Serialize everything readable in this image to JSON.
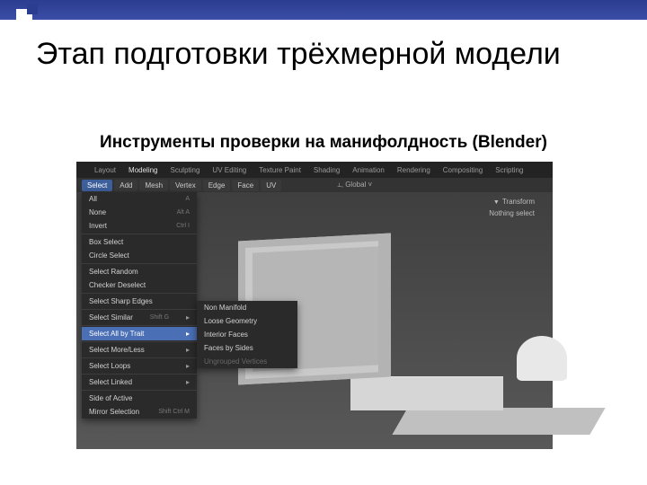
{
  "slide": {
    "title": "Этап подготовки трёхмерной модели",
    "subtitle": "Инструменты проверки на манифолдность (Blender)"
  },
  "tabs": [
    "Layout",
    "Modeling",
    "Sculpting",
    "UV Editing",
    "Texture Paint",
    "Shading",
    "Animation",
    "Rendering",
    "Compositing",
    "Scripting"
  ],
  "bar": {
    "select": "Select",
    "items": [
      "Add",
      "Mesh",
      "Vertex",
      "Edge",
      "Face",
      "UV"
    ],
    "global": "Global"
  },
  "hud": {
    "transform": "Transform",
    "nothing": "Nothing select"
  },
  "menu": [
    {
      "label": "All",
      "hint": "A"
    },
    {
      "label": "None",
      "hint": "Alt A"
    },
    {
      "label": "Invert",
      "hint": "Ctrl I"
    },
    {
      "sep": true
    },
    {
      "label": "Box Select"
    },
    {
      "label": "Circle Select"
    },
    {
      "sep": true
    },
    {
      "label": "Select Random"
    },
    {
      "label": "Checker Deselect"
    },
    {
      "sep": true
    },
    {
      "label": "Select Sharp Edges"
    },
    {
      "sep": true
    },
    {
      "label": "Select Similar",
      "hint": "Shift G",
      "arrow": true
    },
    {
      "sep": true
    },
    {
      "label": "Select All by Trait",
      "arrow": true,
      "hi": true
    },
    {
      "sep": true
    },
    {
      "label": "Select More/Less",
      "arrow": true
    },
    {
      "sep": true
    },
    {
      "label": "Select Loops",
      "arrow": true
    },
    {
      "sep": true
    },
    {
      "label": "Select Linked",
      "arrow": true
    },
    {
      "sep": true
    },
    {
      "label": "Side of Active"
    },
    {
      "label": "Mirror Selection",
      "hint": "Shift Ctrl M"
    }
  ],
  "submenu": [
    {
      "label": "Non Manifold"
    },
    {
      "label": "Loose Geometry"
    },
    {
      "label": "Interior Faces"
    },
    {
      "label": "Faces by Sides"
    },
    {
      "sep": true
    },
    {
      "label": "Ungrouped Vertices",
      "dis": true
    }
  ]
}
